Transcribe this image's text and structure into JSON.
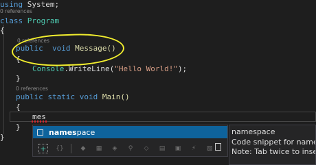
{
  "editor": {
    "refs": {
      "top": "0 references",
      "message": "0 references",
      "main": "0 references"
    },
    "lines": {
      "using_kw": "using",
      "using_ns": "System;",
      "class_kw": "class",
      "class_name": "Program",
      "open_brace": "{",
      "message_kw1": "public",
      "message_kw2": "void",
      "message_name": "Message()",
      "message_open": "{",
      "console_type": "Console",
      "console_call": ".WriteLine(",
      "console_string": "\"Hello World!\"",
      "console_end": ");",
      "message_close": "}",
      "main_kw1": "public",
      "main_kw2": "static",
      "main_kw3": "void",
      "main_name": "Main()",
      "main_open": "{",
      "typed_text": "mes",
      "main_close": "}",
      "class_close": "}"
    },
    "annotation_color": "#f2ee2e"
  },
  "completion": {
    "selected_item": {
      "match": "names",
      "rest": "pace",
      "icon": "snippet-icon"
    },
    "filters": [
      {
        "name": "add-filter-icon",
        "glyph": "+"
      },
      {
        "name": "namespace-filter-icon",
        "glyph": "{}"
      },
      {
        "name": "class-filter-icon",
        "glyph": "◆"
      },
      {
        "name": "struct-filter-icon",
        "glyph": "▦"
      },
      {
        "name": "method-filter-icon",
        "glyph": "◈"
      },
      {
        "name": "property-filter-icon",
        "glyph": "⚲"
      },
      {
        "name": "field-filter-icon",
        "glyph": "◇"
      },
      {
        "name": "enum-filter-icon",
        "glyph": "▤"
      },
      {
        "name": "interface-filter-icon",
        "glyph": "▣"
      },
      {
        "name": "event-filter-icon",
        "glyph": "⚡"
      },
      {
        "name": "delegate-filter-icon",
        "glyph": "▧"
      }
    ]
  },
  "tooltip": {
    "title": "namespace",
    "line1": "Code snippet for namespace",
    "line2": "Note: Tab twice to insert the 'namespace' snippet."
  },
  "colors": {
    "keyword": "#569cd6",
    "type": "#4ec9b0",
    "string": "#d69d85",
    "selection": "#0e639c"
  }
}
